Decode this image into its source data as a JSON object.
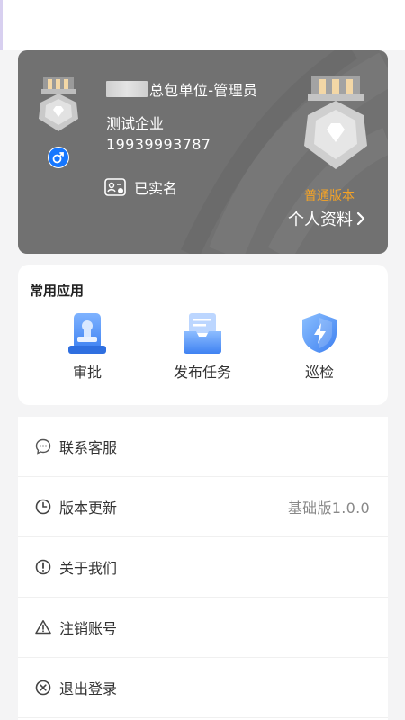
{
  "profile": {
    "name_suffix": "总包单位-管理员",
    "company": "测试企业",
    "phone": "19939993787",
    "verified_label": "已实名",
    "version_label": "普通版本",
    "profile_link_label": "个人资料"
  },
  "apps": {
    "title": "常用应用",
    "items": [
      {
        "label": "审批",
        "icon": "stamp-icon"
      },
      {
        "label": "发布任务",
        "icon": "inbox-tray-icon"
      },
      {
        "label": "巡检",
        "icon": "shield-lightning-icon"
      }
    ]
  },
  "menu": {
    "items": [
      {
        "label": "联系客服",
        "icon": "chat-bubble-icon",
        "value": ""
      },
      {
        "label": "版本更新",
        "icon": "clock-icon",
        "value": "基础版1.0.0"
      },
      {
        "label": "关于我们",
        "icon": "info-exclamation-icon",
        "value": ""
      },
      {
        "label": "注销账号",
        "icon": "warning-triangle-icon",
        "value": ""
      },
      {
        "label": "退出登录",
        "icon": "close-circle-icon",
        "value": ""
      }
    ]
  },
  "colors": {
    "card_bg": "#717171",
    "accent_orange": "#f5a326",
    "icon_blue": "#4a8ef5",
    "gender_blue": "#1677ff"
  }
}
